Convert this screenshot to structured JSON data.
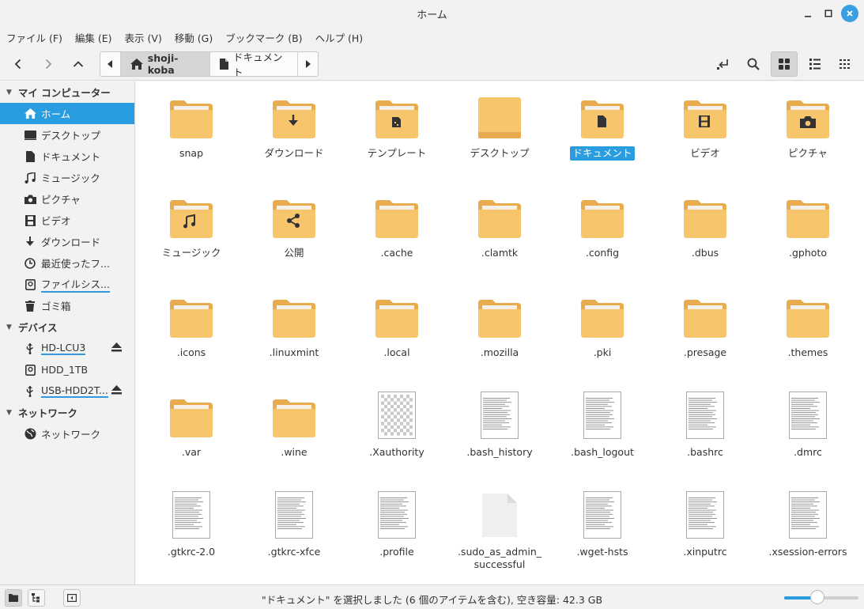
{
  "window": {
    "title": "ホーム"
  },
  "menu": [
    "ファイル (F)",
    "編集 (E)",
    "表示 (V)",
    "移動 (G)",
    "ブックマーク (B)",
    "ヘルプ (H)"
  ],
  "breadcrumb": {
    "current": "shoji-koba",
    "next": "ドキュメント"
  },
  "sidebar": {
    "sections": [
      {
        "title": "マイ コンピューター",
        "items": [
          {
            "label": "ホーム",
            "icon": "home-icon",
            "selected": true
          },
          {
            "label": "デスクトップ",
            "icon": "desktop-icon"
          },
          {
            "label": "ドキュメント",
            "icon": "document-icon"
          },
          {
            "label": "ミュージック",
            "icon": "music-icon"
          },
          {
            "label": "ピクチャ",
            "icon": "camera-icon"
          },
          {
            "label": "ビデオ",
            "icon": "video-icon"
          },
          {
            "label": "ダウンロード",
            "icon": "download-icon"
          },
          {
            "label": "最近使ったフ...",
            "icon": "recent-icon"
          },
          {
            "label": "ファイルシス...",
            "icon": "drive-icon",
            "underline": true
          },
          {
            "label": "ゴミ箱",
            "icon": "trash-icon"
          }
        ]
      },
      {
        "title": "デバイス",
        "items": [
          {
            "label": "HD-LCU3",
            "icon": "usb-icon",
            "underline": true,
            "eject": true
          },
          {
            "label": "HDD_1TB",
            "icon": "drive-icon"
          },
          {
            "label": "USB-HDD2T...",
            "icon": "usb-icon",
            "underline": true,
            "eject": true
          }
        ]
      },
      {
        "title": "ネットワーク",
        "items": [
          {
            "label": "ネットワーク",
            "icon": "network-icon"
          }
        ]
      }
    ]
  },
  "files": [
    {
      "name": "snap",
      "type": "folder",
      "emblem": ""
    },
    {
      "name": "ダウンロード",
      "type": "folder",
      "emblem": "download"
    },
    {
      "name": "テンプレート",
      "type": "folder",
      "emblem": "template"
    },
    {
      "name": "デスクトップ",
      "type": "desktop-folder",
      "emblem": ""
    },
    {
      "name": "ドキュメント",
      "type": "folder",
      "emblem": "document",
      "selected": true
    },
    {
      "name": "ビデオ",
      "type": "folder",
      "emblem": "video"
    },
    {
      "name": "ピクチャ",
      "type": "folder",
      "emblem": "camera"
    },
    {
      "name": "ミュージック",
      "type": "folder",
      "emblem": "music"
    },
    {
      "name": "公開",
      "type": "folder",
      "emblem": "share"
    },
    {
      "name": ".cache",
      "type": "folder",
      "emblem": ""
    },
    {
      "name": ".clamtk",
      "type": "folder",
      "emblem": ""
    },
    {
      "name": ".config",
      "type": "folder",
      "emblem": ""
    },
    {
      "name": ".dbus",
      "type": "folder",
      "emblem": ""
    },
    {
      "name": ".gphoto",
      "type": "folder",
      "emblem": ""
    },
    {
      "name": ".icons",
      "type": "folder",
      "emblem": ""
    },
    {
      "name": ".linuxmint",
      "type": "folder",
      "emblem": ""
    },
    {
      "name": ".local",
      "type": "folder",
      "emblem": ""
    },
    {
      "name": ".mozilla",
      "type": "folder",
      "emblem": ""
    },
    {
      "name": ".pki",
      "type": "folder",
      "emblem": ""
    },
    {
      "name": ".presage",
      "type": "folder",
      "emblem": ""
    },
    {
      "name": ".themes",
      "type": "folder",
      "emblem": ""
    },
    {
      "name": ".var",
      "type": "folder",
      "emblem": ""
    },
    {
      "name": ".wine",
      "type": "folder",
      "emblem": ""
    },
    {
      "name": ".Xauthority",
      "type": "checker-file",
      "emblem": ""
    },
    {
      "name": ".bash_history",
      "type": "text-file",
      "emblem": ""
    },
    {
      "name": ".bash_logout",
      "type": "text-file",
      "emblem": ""
    },
    {
      "name": ".bashrc",
      "type": "text-file",
      "emblem": ""
    },
    {
      "name": ".dmrc",
      "type": "text-file",
      "emblem": ""
    },
    {
      "name": ".gtkrc-2.0",
      "type": "text-file",
      "emblem": ""
    },
    {
      "name": ".gtkrc-xfce",
      "type": "text-file",
      "emblem": ""
    },
    {
      "name": ".profile",
      "type": "text-file",
      "emblem": ""
    },
    {
      "name": ".sudo_as_admin_\nsuccessful",
      "type": "blank-file",
      "emblem": ""
    },
    {
      "name": ".wget-hsts",
      "type": "text-file",
      "emblem": ""
    },
    {
      "name": ".xinputrc",
      "type": "text-file",
      "emblem": ""
    },
    {
      "name": ".xsession-errors",
      "type": "text-file",
      "emblem": ""
    }
  ],
  "status": {
    "text": "\"ドキュメント\" を選択しました (6 個のアイテムを含む), 空き容量: 42.3 GB",
    "zoom": 0.45
  },
  "colors": {
    "accent": "#2a9de0",
    "folder": "#f7c56b",
    "folder_light": "#fbd58a"
  }
}
